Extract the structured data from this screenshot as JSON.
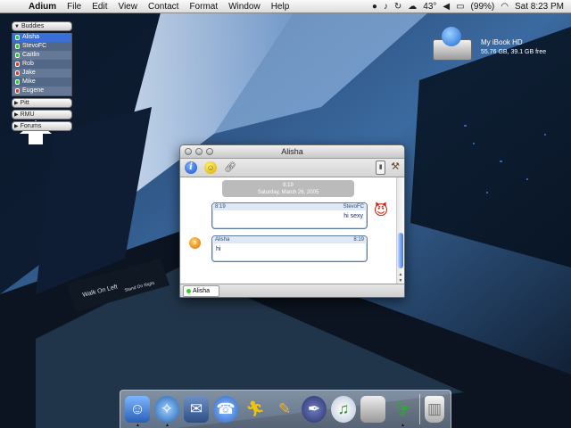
{
  "menubar": {
    "app_name": "Adium",
    "menus": [
      "File",
      "Edit",
      "View",
      "Contact",
      "Format",
      "Window",
      "Help"
    ],
    "temperature": "43°",
    "battery": "(99%)",
    "clock": "Sat 8:23 PM"
  },
  "buddylist": {
    "groups": [
      {
        "label": "Buddies",
        "expanded": true
      },
      {
        "label": "Pitt",
        "expanded": false
      },
      {
        "label": "RMU",
        "expanded": false
      },
      {
        "label": "Forums",
        "expanded": false
      }
    ],
    "buddies": [
      "Alisha",
      "StevoFC",
      "Caitlin",
      "Rob",
      "Jake",
      "Mike",
      "Eugene"
    ]
  },
  "desktop": {
    "disk_name": "My iBook HD",
    "disk_info": "55.76 GB, 39.1 GB free"
  },
  "chat": {
    "title": "Alisha",
    "date_time": "8:19",
    "date_label": "Saturday, March 26, 2005",
    "messages": [
      {
        "time": "8:19",
        "sender": "StevoFC",
        "text": "hi sexy"
      },
      {
        "time": "8:19",
        "sender": "Alisha",
        "text": "hi"
      }
    ],
    "tab_label": "Alisha"
  },
  "dock": {
    "items": [
      "finder-icon",
      "safari-icon",
      "mail-icon",
      "ichat-icon",
      "aim-icon",
      "pen-icon",
      "quill-icon",
      "itunes-icon",
      "system-prefs-icon",
      "adium-duck-icon",
      "trash-icon"
    ]
  }
}
